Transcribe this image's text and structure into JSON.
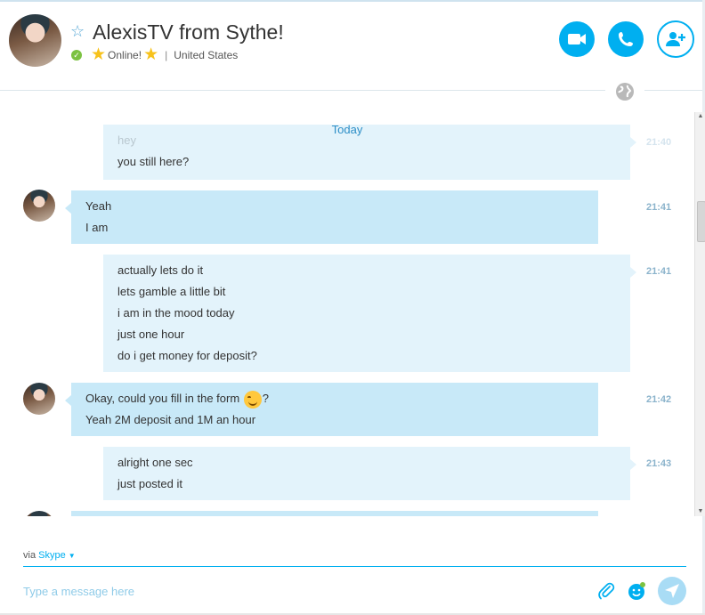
{
  "header": {
    "contact_name": "AlexisTV from Sythe!",
    "status": "Online!",
    "location": "United States",
    "buttons": {
      "video_call": "video-call",
      "voice_call": "voice-call",
      "add_people": "add-people"
    }
  },
  "chat": {
    "date_label": "Today",
    "messages": [
      {
        "sender": "me",
        "lines": [
          "hey",
          "you still here?"
        ],
        "time": "21:40"
      },
      {
        "sender": "contact",
        "lines": [
          "Yeah",
          "I am"
        ],
        "time": "21:41"
      },
      {
        "sender": "me",
        "lines": [
          "actually lets do it",
          "lets gamble a little bit",
          "i am in the mood today",
          "just one hour",
          "do i get money for deposit?"
        ],
        "time": "21:41"
      },
      {
        "sender": "contact",
        "lines": [
          "Okay, could you fill in the form",
          "?",
          "Yeah 2M deposit and 1M an hour"
        ],
        "time": "21:42"
      },
      {
        "sender": "me",
        "lines": [
          "alright one sec",
          "just posted it"
        ],
        "time": "21:43"
      }
    ]
  },
  "compose": {
    "via_label": "via",
    "service": "Skype",
    "placeholder": "Type a message here"
  },
  "colors": {
    "accent": "#00aff0",
    "bubble_me": "#e3f3fb",
    "bubble_contact": "#c8e9f8",
    "online": "#7cc242",
    "star": "#f7c21b"
  },
  "icons": [
    "favorite-star-icon",
    "online-check-icon",
    "mood-star-icon",
    "video-camera-icon",
    "phone-icon",
    "add-person-icon",
    "globe-icon",
    "paperclip-icon",
    "emoticon-icon",
    "send-icon"
  ]
}
